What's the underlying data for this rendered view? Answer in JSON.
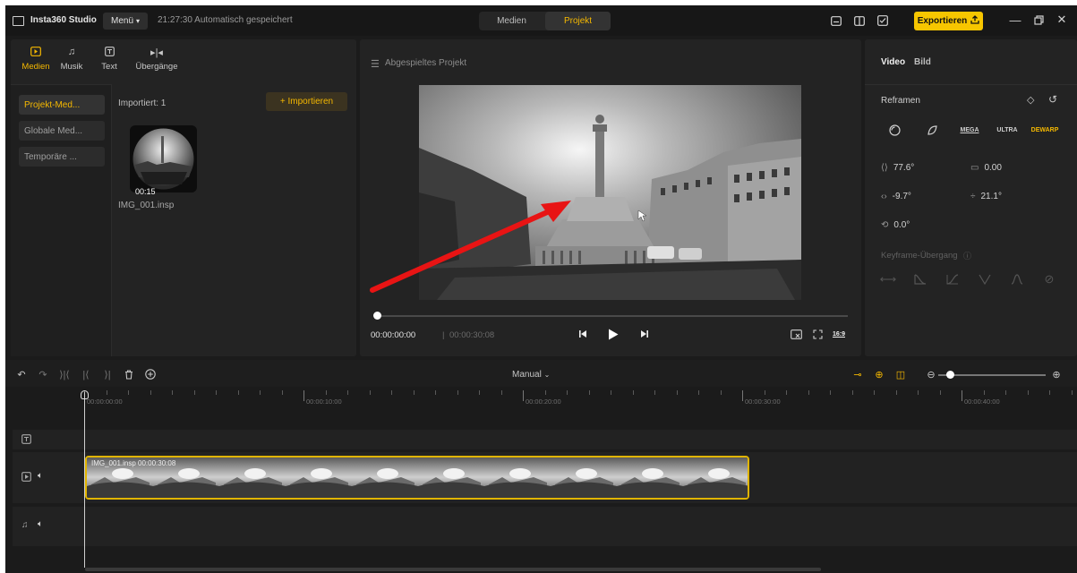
{
  "app": {
    "title": "Insta360 Studio",
    "menu_label": "Menü",
    "save_status": "21:27:30 Automatisch gespeichert"
  },
  "mode_toggle": {
    "media": "Medien",
    "project": "Projekt"
  },
  "export": {
    "label": "Exportieren"
  },
  "media_tabs": [
    {
      "label": "Medien",
      "icon": "media-icon"
    },
    {
      "label": "Musik",
      "icon": "music-icon"
    },
    {
      "label": "Text",
      "icon": "text-icon"
    },
    {
      "label": "Übergänge",
      "icon": "transitions-icon"
    }
  ],
  "media_sidebar": [
    "Projekt-Med...",
    "Globale Med...",
    "Temporäre ..."
  ],
  "media_content": {
    "import_count": "Importiert: 1",
    "import_button": "+ Importieren",
    "thumb_duration": "00:15",
    "thumb_name": "IMG_001.insp"
  },
  "preview": {
    "title": "Abgespieltes Projekt",
    "time_current": "00:00:00:00",
    "time_separator": "|",
    "time_total": "00:00:30:08",
    "aspect": "16:9"
  },
  "props": {
    "tabs": [
      "Video",
      "Bild"
    ],
    "reframe_title": "Reframen",
    "modes": [
      "",
      "",
      "MEGA",
      "ULTRA",
      "DEWARP"
    ],
    "params": {
      "fov": "77.6°",
      "distance": "0.00",
      "pan": "-9.7°",
      "tilt": "21.1°",
      "roll": "0.0°"
    },
    "keyframe_title": "Keyframe-Übergang",
    "colors": {
      "accent": "#f5b800",
      "export": "#f7c600"
    }
  },
  "timeline": {
    "mode": "Manual",
    "ruler_labels": [
      "00:00:00:00",
      "00:00:10:00",
      "00:00:20:00",
      "00:00:30:00",
      "00:00:40:00"
    ],
    "clip_label": "IMG_001.insp  00:00:30:08"
  }
}
